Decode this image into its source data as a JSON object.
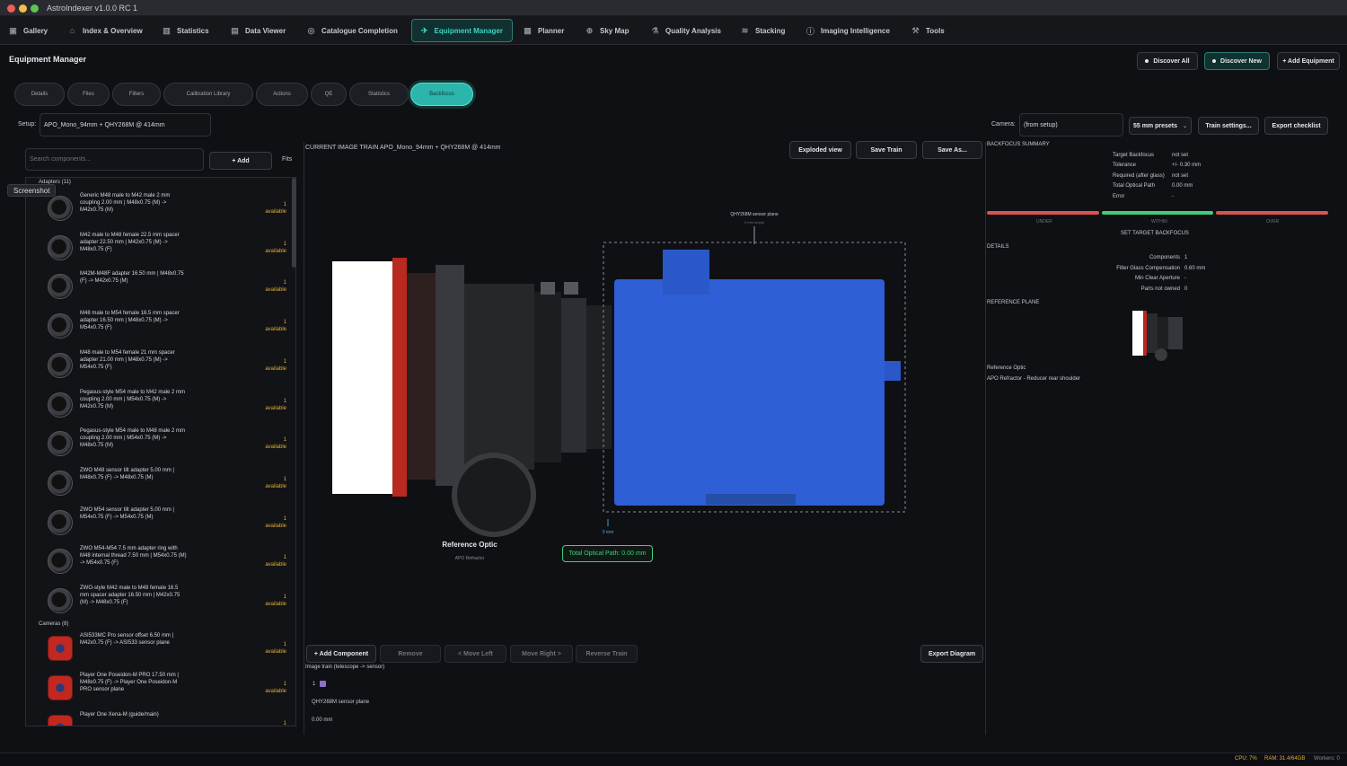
{
  "app": {
    "title": "AstroIndexer v1.0.0 RC 1"
  },
  "nav": [
    {
      "label": "Gallery",
      "icon": "gallery-icon"
    },
    {
      "label": "Index & Overview",
      "icon": "home-icon"
    },
    {
      "label": "Statistics",
      "icon": "bar-chart-icon"
    },
    {
      "label": "Data Viewer",
      "icon": "document-icon"
    },
    {
      "label": "Catalogue Completion",
      "icon": "target-icon"
    },
    {
      "label": "Equipment Manager",
      "icon": "telescope-icon"
    },
    {
      "label": "Planner",
      "icon": "calendar-icon"
    },
    {
      "label": "Sky Map",
      "icon": "globe-icon"
    },
    {
      "label": "Quality Analysis",
      "icon": "flask-icon"
    },
    {
      "label": "Stacking",
      "icon": "layers-icon"
    },
    {
      "label": "Imaging Intelligence",
      "icon": "info-icon"
    },
    {
      "label": "Tools",
      "icon": "wrench-icon"
    }
  ],
  "page": {
    "title": "Equipment Manager",
    "discover_all": "Discover All",
    "discover_new": "Discover New",
    "add_equipment": "+ Add Equipment"
  },
  "tabs": [
    "Details",
    "Files",
    "Filters",
    "Calibration Library",
    "Actions",
    "QE",
    "Statistics",
    "Backfocus"
  ],
  "setup": {
    "label": "Setup:",
    "value": "APO_Mono_94mm + QHY268M @ 414mm",
    "camera_label": "Camera:",
    "camera_value": "(from setup)",
    "presets": "55 mm presets",
    "train_settings": "Train settings...",
    "export_checklist": "Export checklist"
  },
  "library": {
    "search_placeholder": "Search components...",
    "add": "+ Add",
    "fits": "Fits",
    "tooltip": "Screenshot",
    "adapters_label": "Adapters (11)",
    "cameras_label": "Cameras (8)",
    "adapters": [
      {
        "text": "Generic M48 male to M42 male 2 mm coupling 2.00 mm | M48x0.75 (M) -> M42x0.75 (M)",
        "qty": "1",
        "status": "available"
      },
      {
        "text": "M42 male to M48 female 22.5 mm spacer adapter 22.50 mm | M42x0.75 (M) -> M48x0.75 (F)",
        "qty": "1",
        "status": "available"
      },
      {
        "text": "M42M-M48F adapter 16.50 mm | M48x0.75 (F) -> M42x0.75 (M)",
        "qty": "1",
        "status": "available"
      },
      {
        "text": "M48 male to M54 female 16.5 mm spacer adapter 16.50 mm | M48x0.75 (M) -> M54x0.75 (F)",
        "qty": "1",
        "status": "available"
      },
      {
        "text": "M48 male to M54 female 21 mm spacer adapter 21.00 mm | M48x0.75 (M) -> M54x0.75 (F)",
        "qty": "1",
        "status": "available"
      },
      {
        "text": "Pegasus-style M54 male to M42 male 2 mm coupling 2.00 mm | M54x0.75 (M) -> M42x0.75 (M)",
        "qty": "1",
        "status": "available"
      },
      {
        "text": "Pegasus-style M54 male to M48 male 2 mm coupling 2.00 mm | M54x0.75 (M) -> M48x0.75 (M)",
        "qty": "1",
        "status": "available"
      },
      {
        "text": "ZWO M48 sensor tilt adapter 5.00 mm | M48x0.75 (F) -> M48x0.75 (M)",
        "qty": "1",
        "status": "available"
      },
      {
        "text": "ZWO M54 sensor tilt adapter 5.00 mm | M54x0.75 (F) -> M54x0.75 (M)",
        "qty": "1",
        "status": "available"
      },
      {
        "text": "ZWO M54-M54 7.5 mm adapter ring with M48 internal thread 7.50 mm | M54x0.75 (M) -> M54x0.75 (F)",
        "qty": "1",
        "status": "available"
      },
      {
        "text": "ZWO-style M42 male to M48 female 16.5 mm spacer adapter 16.50 mm | M42x0.75 (M) -> M48x0.75 (F)",
        "qty": "1",
        "status": "available"
      }
    ],
    "cameras": [
      {
        "text": "ASI533MC Pro sensor offset 6.50 mm | M42x0.75 (F) -> ASI533 sensor plane",
        "qty": "1",
        "status": "available"
      },
      {
        "text": "Player One Poseidon-M PRO 17.50 mm | M48x0.75 (F) -> Player One Poseidon-M PRO sensor plane",
        "qty": "1",
        "status": "available"
      },
      {
        "text": "Player One Xena-M (guide/main)",
        "qty": "1",
        "status": ""
      }
    ]
  },
  "train": {
    "header": "CURRENT IMAGE TRAIN  APO_Mono_94mm + QHY268M @ 414mm",
    "exploded": "Exploded view",
    "save": "Save Train",
    "save_as": "Save As...",
    "sensor_plane": "QHY268M sensor plane",
    "sensor_len": "0 mm length",
    "zero_mm": "0 mm",
    "ref_title": "Reference Optic",
    "ref_sub": "APO Refractor",
    "total_path": "Total Optical Path: 0.00 mm",
    "add_component": "+ Add Component",
    "remove": "Remove",
    "move_left": "< Move Left",
    "move_right": "Move Right >",
    "reverse": "Reverse Train",
    "export_diagram": "Export Diagram",
    "list_title": "Image train  (telescope -> sensor)",
    "list_index": "1",
    "list_name": "QHY268M sensor plane",
    "list_len": "0.00 mm",
    "colors": {
      "camera": "#2f5fd6",
      "red": "#c0271d",
      "accent": "#3fd1c4"
    }
  },
  "summary": {
    "title": "BACKFOCUS SUMMARY",
    "rows": [
      {
        "k": "Target Backfocus",
        "v": "not set"
      },
      {
        "k": "Tolerance",
        "v": "+/- 0.30 mm"
      },
      {
        "k": "Required (after glass)",
        "v": "not set"
      },
      {
        "k": "Total Optical Path",
        "v": "0.00 mm"
      },
      {
        "k": "Error",
        "v": "-"
      }
    ],
    "under": "UNDER",
    "within": "WITHIN",
    "over": "OVER",
    "set_target": "SET TARGET BACKFOCUS",
    "details_title": "DETAILS",
    "details": [
      {
        "k": "Components",
        "v": "1"
      },
      {
        "k": "Filter Glass Compensation",
        "v": "0.60 mm"
      },
      {
        "k": "Min Clear Aperture",
        "v": "-"
      },
      {
        "k": "Parts not owned",
        "v": "0"
      }
    ],
    "ref_plane_title": "REFERENCE PLANE",
    "ref_optic_label": "Reference Optic",
    "ref_optic_value": "APO Refractor - Reducer rear shoulder",
    "colors": {
      "under": "#d9534f",
      "within": "#3fcf7a",
      "over": "#d9534f"
    }
  },
  "status": {
    "cpu": "CPU: 7%",
    "ram": "RAM: 31.4/64GB",
    "workers": "Workers: 0"
  }
}
